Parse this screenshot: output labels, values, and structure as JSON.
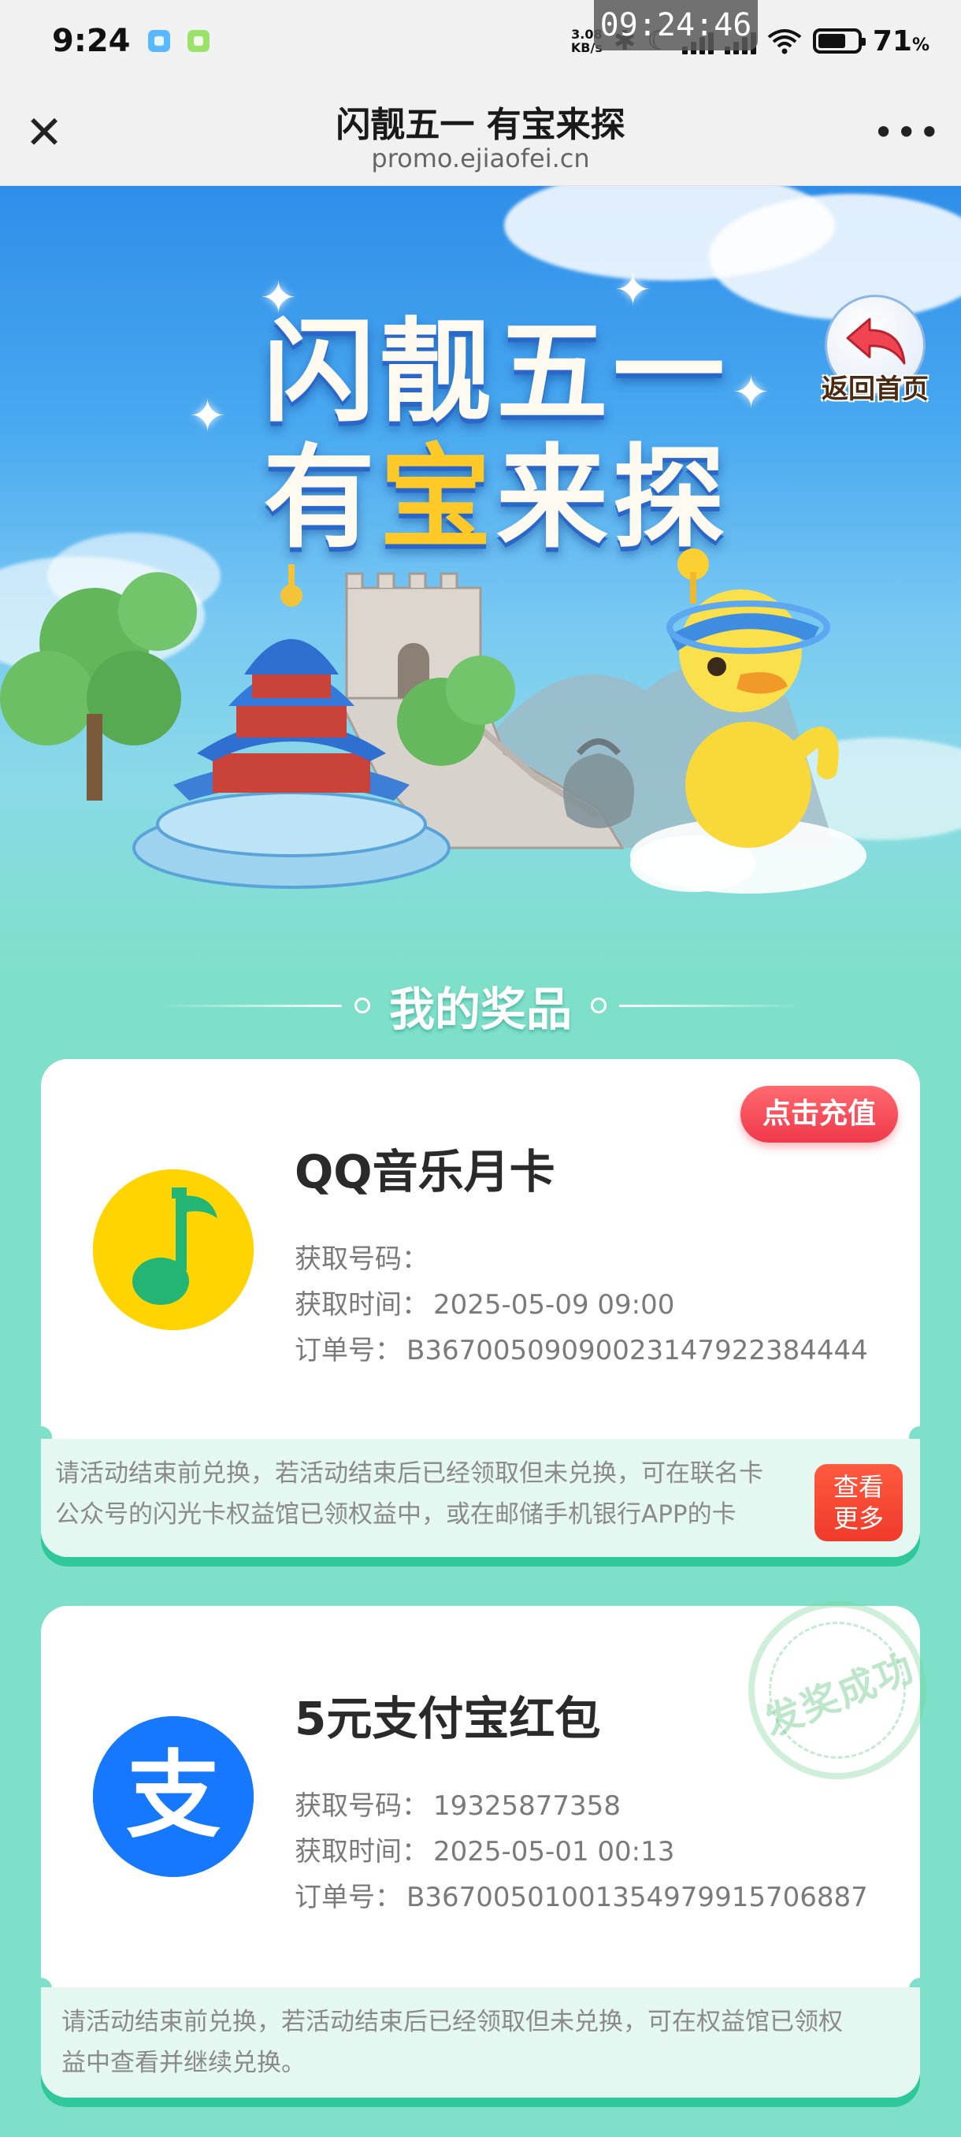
{
  "status_bar": {
    "time": "9:24",
    "net_speed_value": "3.08",
    "net_speed_unit": "KB/s",
    "battery_percent": "71",
    "battery_unit": "%",
    "clock_overlay": "09:24:46",
    "icons": [
      "app-notification-icon",
      "wechat-icon",
      "bluetooth-icon",
      "moon-icon",
      "signal-icon",
      "wifi-icon",
      "battery-icon"
    ]
  },
  "browser": {
    "title": "闪靓五一 有宝来探",
    "url": "promo.ejiaofei.cn",
    "close_glyph": "✕",
    "more_glyph": "•••"
  },
  "hero": {
    "title_line1": "闪靓五一",
    "title_line2_a": "有",
    "title_line2_gold": "宝",
    "title_line2_b": "来探",
    "back_home_label": "返回首页"
  },
  "section": {
    "title": "我的奖品"
  },
  "prizes": [
    {
      "name": "QQ音乐月卡",
      "code_label": "获取号码：",
      "code_value": "",
      "time_label": "获取时间：",
      "time_value": "2025-05-09 09:00",
      "order_label": "订单号：",
      "order_value": "B36700509090023147922384444",
      "action_label": "点击充值",
      "notice_line1": "请活动结束前兑换，若活动结束后已经领取但未兑换，可在联名卡",
      "notice_line2": "公众号的闪光卡权益馆已领权益中，或在邮储手机银行APP的卡",
      "more_label_1": "查看",
      "more_label_2": "更多",
      "icon": "qq-music-icon"
    },
    {
      "name": "5元支付宝红包",
      "code_label": "获取号码：",
      "code_value": "19325877358",
      "time_label": "获取时间：",
      "time_value": "2025-05-01 00:13",
      "order_label": "订单号：",
      "order_value": "B36700501001354979915706887",
      "stamp_text": "发奖成功",
      "notice_line1": "请活动结束前兑换，若活动结束后已经领取但未兑换，可在权益馆已领权",
      "notice_line2": "益中查看并继续兑换。",
      "icon": "alipay-icon",
      "icon_glyph": "支"
    }
  ],
  "colors": {
    "accent_red": "#f0394a",
    "accent_green": "#2ec89a",
    "page_bg": "#7fe0c9",
    "sky_blue": "#2f8ee8",
    "gold": "#ffc928"
  }
}
